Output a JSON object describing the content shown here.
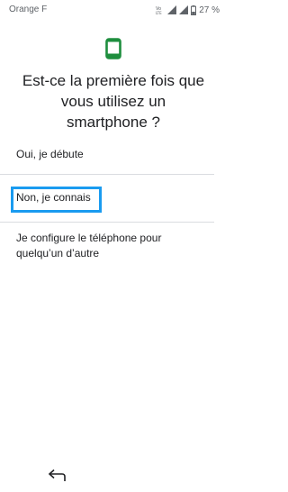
{
  "status_bar": {
    "carrier": "Orange F",
    "volte_label": "Vo\nLTE",
    "battery_percent": "27 %",
    "icons": [
      "volte-icon",
      "wifi-icon",
      "signal-icon",
      "battery-icon"
    ]
  },
  "header": {
    "icon": "smartphone-icon",
    "icon_color": "#1e8e3e",
    "question": "Est-ce la première fois que\nvous utilisez un\nsmartphone ?"
  },
  "options": [
    {
      "label": "Oui, je débute"
    },
    {
      "label": "Non, je connais",
      "focused": true
    },
    {
      "label": "Je configure le téléphone pour\nquelqu’un d’autre"
    }
  ],
  "focus_color": "#1a9bf0",
  "navigation": {
    "back_icon": "back-arrow-icon"
  }
}
